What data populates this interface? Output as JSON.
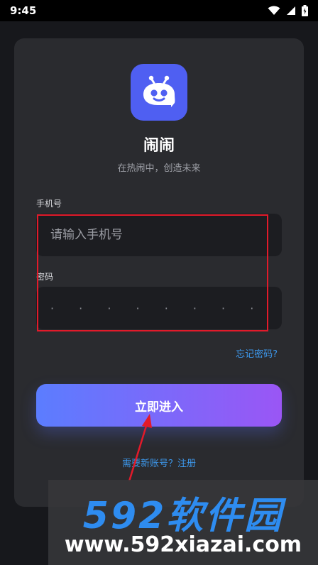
{
  "status_bar": {
    "time": "9:45"
  },
  "app": {
    "name": "闹闹",
    "tagline": "在热闹中，创造未来"
  },
  "form": {
    "phone_label": "手机号",
    "phone_placeholder": "请输入手机号",
    "password_label": "密码",
    "password_mask": "· · · · · · · ·",
    "forgot_password": "忘记密码?",
    "submit_label": "立即进入",
    "register_link": "需要新账号？注册"
  },
  "watermark": {
    "logo_text": "592软件园",
    "url": "www.592xiazai.com"
  },
  "colors": {
    "background": "#17181c",
    "card": "#2a2b2f",
    "accent": "#4f5ff2",
    "gradient_start": "#5b7dff",
    "gradient_end": "#9a56f5",
    "link": "#3d99ee",
    "annotation": "#e21a2a"
  },
  "icons": [
    "wifi-icon",
    "signal-icon",
    "battery-icon",
    "robot-chat-icon"
  ]
}
